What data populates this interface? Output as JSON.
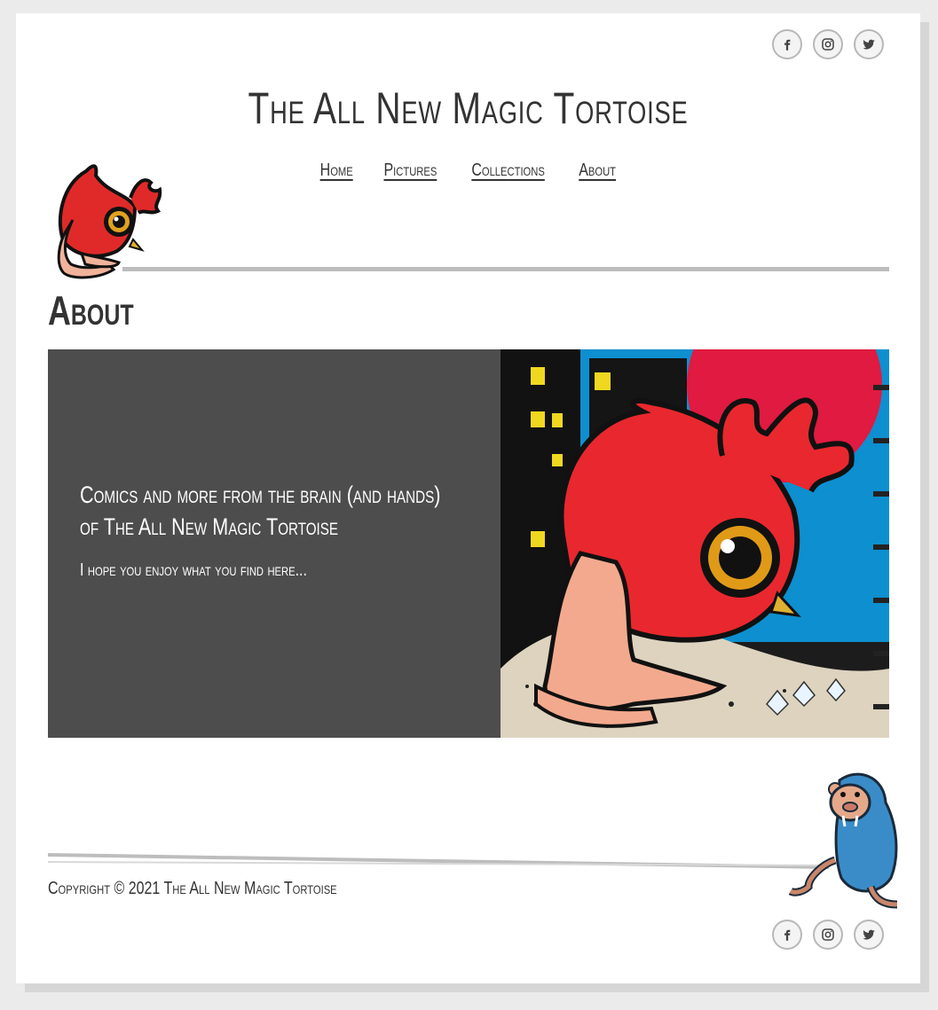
{
  "site": {
    "title": "The All New Magic Tortoise"
  },
  "social": {
    "facebook_icon": "facebook-icon",
    "instagram_icon": "instagram-icon",
    "twitter_icon": "twitter-icon"
  },
  "nav": {
    "items": [
      {
        "label": "Home"
      },
      {
        "label": "Pictures"
      },
      {
        "label": "Collections"
      },
      {
        "label": "About"
      }
    ]
  },
  "page": {
    "heading": "About"
  },
  "hero": {
    "lead": "Comics and more from the brain (and hands) of The All New Magic Tortoise",
    "sub": "I hope you enjoy what you find here..."
  },
  "footer": {
    "copyright": "Copyright © 2021 The All New Magic Tortoise"
  },
  "colors": {
    "background": "#ebebeb",
    "page": "#ffffff",
    "hero_panel": "#4d4d4d",
    "text": "#333333",
    "rule": "#bdbdbd"
  }
}
